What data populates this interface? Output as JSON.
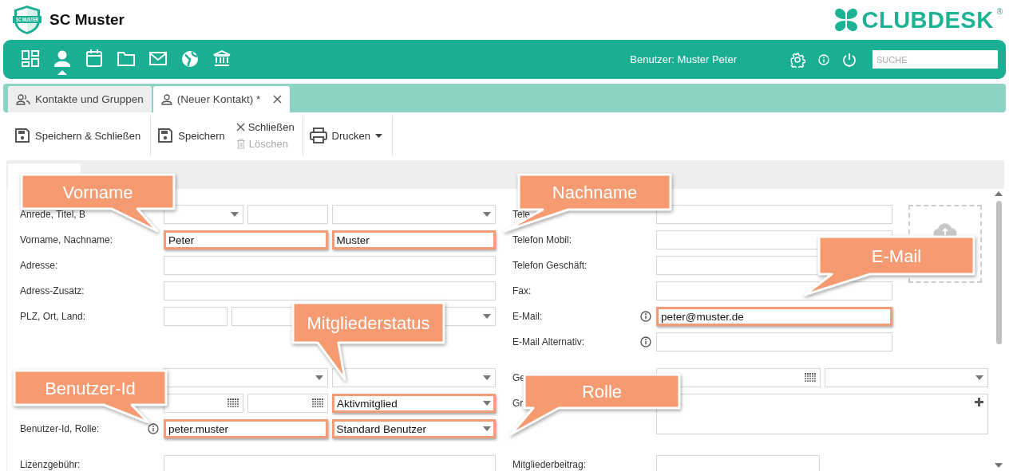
{
  "header": {
    "logo_text": "SC MUSTER",
    "club_name": "SC Muster",
    "brand": "CLUBDESK",
    "brand_mark": "®"
  },
  "nav": {
    "icons": [
      {
        "kind": "dashboard",
        "selected": false
      },
      {
        "kind": "person",
        "selected": true
      },
      {
        "kind": "calendar",
        "selected": false
      },
      {
        "kind": "folder",
        "selected": false
      },
      {
        "kind": "mail",
        "selected": false
      },
      {
        "kind": "globe",
        "selected": false
      },
      {
        "kind": "bank",
        "selected": false
      }
    ],
    "user_label": "Benutzer: Muster Peter",
    "search": {
      "placeholder": "SUCHE"
    }
  },
  "tabs": [
    {
      "label": "Kontakte und Gruppen",
      "kind": "group",
      "selected": false,
      "closable": false
    },
    {
      "label": "(Neuer Kontakt) *",
      "kind": "person",
      "selected": true,
      "closable": true
    }
  ],
  "toolbar": {
    "groups": [
      {
        "buttons": [
          {
            "label": "Speichern & Schließen",
            "kind": "save",
            "disabled": false,
            "dropdown": false
          }
        ]
      },
      {
        "buttons": [
          {
            "label": "Speichern",
            "kind": "save",
            "disabled": false,
            "dropdown": false
          }
        ],
        "stacked": [
          {
            "label": "Schließen",
            "kind": "close",
            "disabled": false,
            "dropdown": false
          },
          {
            "label": "Löschen",
            "kind": "delete",
            "disabled": true,
            "dropdown": false
          }
        ]
      },
      {
        "buttons": [
          {
            "label": "Drucken",
            "kind": "print",
            "disabled": false,
            "dropdown": true
          }
        ]
      }
    ]
  },
  "form": {
    "left_sections": [
      {
        "rows": [
          {
            "label": "Anrede, Titel, B",
            "info": false,
            "kind": "triple",
            "fields": [
              {
                "kind": "select",
                "highlighted": false
              },
              {
                "kind": "text",
                "highlighted": false
              },
              {
                "kind": "select",
                "highlighted": false
              }
            ]
          },
          {
            "label": "Vorname, Nachname:",
            "info": false,
            "kind": "pair",
            "fields": [
              {
                "kind": "text",
                "value": "Peter",
                "highlighted": true
              },
              {
                "kind": "text",
                "value": "Muster",
                "highlighted": true
              }
            ]
          },
          {
            "label": "Adresse:",
            "info": false,
            "kind": "single",
            "fields": [
              {
                "kind": "text",
                "highlighted": false
              }
            ]
          },
          {
            "label": "Adress-Zusatz:",
            "info": false,
            "kind": "single",
            "fields": [
              {
                "kind": "text",
                "highlighted": false
              }
            ]
          },
          {
            "label": "PLZ, Ort, Land:",
            "info": false,
            "kind": "plz",
            "fields": [
              {
                "kind": "text",
                "highlighted": false
              },
              {
                "kind": "text",
                "highlighted": false
              },
              {
                "kind": "select",
                "highlighted": false
              }
            ]
          }
        ]
      },
      {
        "rows": [
          {
            "info": false,
            "kind": "pair",
            "fields": [
              {
                "kind": "select",
                "highlighted": false
              },
              {
                "kind": "select",
                "highlighted": false
              }
            ]
          },
          {
            "info": false,
            "kind": "triple",
            "fields": [
              {
                "kind": "date",
                "highlighted": false
              },
              {
                "kind": "date",
                "highlighted": false
              },
              {
                "kind": "select",
                "value": "Aktivmitglied",
                "highlighted": true
              }
            ]
          },
          {
            "label": "Benutzer-Id, Rolle:",
            "info": true,
            "kind": "pair",
            "fields": [
              {
                "kind": "text",
                "value": "peter.muster",
                "highlighted": true
              },
              {
                "kind": "select",
                "value": "Standard Benutzer",
                "highlighted": true
              }
            ]
          }
        ]
      },
      {
        "rows": [
          {
            "label": "Lizenzgebühr:",
            "info": false,
            "kind": "single",
            "fields": [
              {
                "kind": "text",
                "highlighted": false
              }
            ]
          }
        ]
      }
    ],
    "right_sections": [
      {
        "photo_box": true,
        "rows": [
          {
            "label": "Tele",
            "info": false,
            "kind": "short",
            "fields": [
              {
                "kind": "text",
                "highlighted": false
              }
            ]
          },
          {
            "label": "Telefon Mobil:",
            "info": false,
            "kind": "short",
            "fields": [
              {
                "kind": "text",
                "highlighted": false
              }
            ]
          },
          {
            "label": "Telefon Geschäft:",
            "info": false,
            "kind": "short",
            "fields": [
              {
                "kind": "text",
                "highlighted": false
              }
            ]
          },
          {
            "label": "Fax:",
            "info": false,
            "kind": "short",
            "fields": [
              {
                "kind": "text",
                "highlighted": false
              }
            ]
          },
          {
            "label": "E-Mail:",
            "info": true,
            "kind": "short",
            "fields": [
              {
                "kind": "text",
                "value": "peter@muster.de",
                "highlighted": true
              }
            ]
          },
          {
            "label": "E-Mail Alternativ:",
            "info": true,
            "kind": "short",
            "fields": [
              {
                "kind": "text",
                "highlighted": false
              }
            ]
          }
        ]
      },
      {
        "rows": [
          {
            "label": "Ge",
            "info": false,
            "kind": "pair",
            "fields": [
              {
                "kind": "date",
                "highlighted": false
              },
              {
                "kind": "select",
                "highlighted": false
              }
            ]
          },
          {
            "label": "Gr",
            "info": false,
            "kind": "groups",
            "fields": [
              {
                "kind": "list",
                "highlighted": false
              }
            ]
          }
        ]
      },
      {
        "rows": [
          {
            "label": "Mitgliederbeitrag:",
            "info": false,
            "kind": "half",
            "fields": [
              {
                "kind": "text",
                "highlighted": false
              }
            ]
          }
        ]
      }
    ]
  },
  "callouts": [
    {
      "text": "Vorname"
    },
    {
      "text": "Nachname"
    },
    {
      "text": "E-Mail"
    },
    {
      "text": "Mitgliederstatus"
    },
    {
      "text": "Benutzer-Id"
    },
    {
      "text": "Rolle"
    }
  ]
}
